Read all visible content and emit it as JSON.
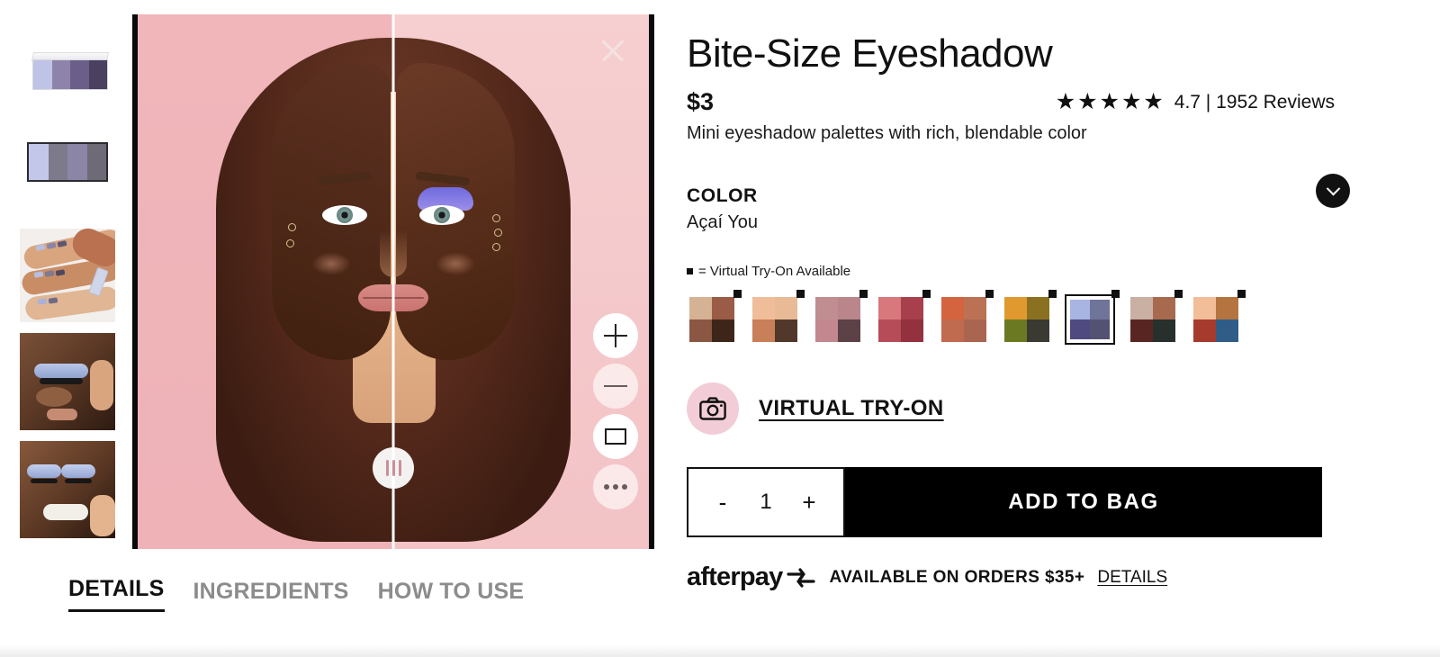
{
  "product": {
    "title": "Bite-Size Eyeshadow",
    "price": "$3",
    "rating_stars": "★★★★★",
    "rating_text": "4.7  |  1952 Reviews",
    "subtitle": "Mini eyeshadow palettes with rich, blendable color"
  },
  "color_section": {
    "label": "COLOR",
    "selected_value": "Açaí You",
    "vto_note": "= Virtual Try-On Available",
    "expand_icon": "chevron-down-icon",
    "swatches": [
      {
        "name": "swatch-1",
        "vto": true,
        "selected": false,
        "colors": [
          "#d6b295",
          "#9a5c46",
          "#8c5742",
          "#3d2619"
        ]
      },
      {
        "name": "swatch-2",
        "vto": true,
        "selected": false,
        "colors": [
          "#f0bd9a",
          "#e8ba95",
          "#c97f57",
          "#51382a"
        ]
      },
      {
        "name": "swatch-3",
        "vto": true,
        "selected": false,
        "colors": [
          "#c08d90",
          "#ba868c",
          "#c2878f",
          "#5c4147"
        ]
      },
      {
        "name": "swatch-4",
        "vto": true,
        "selected": false,
        "colors": [
          "#d8777c",
          "#a83f4c",
          "#b74c59",
          "#93313e"
        ]
      },
      {
        "name": "swatch-5",
        "vto": true,
        "selected": false,
        "colors": [
          "#d4643f",
          "#bb7254",
          "#c06a4f",
          "#a9654f"
        ]
      },
      {
        "name": "swatch-6",
        "vto": true,
        "selected": false,
        "colors": [
          "#e0992f",
          "#8a7121",
          "#6b7a22",
          "#3a3a33"
        ]
      },
      {
        "name": "swatch-7",
        "vto": true,
        "selected": true,
        "colors": [
          "#a8b4e2",
          "#6f7499",
          "#4f4a80",
          "#545273"
        ]
      },
      {
        "name": "swatch-8",
        "vto": true,
        "selected": false,
        "colors": [
          "#c9b0a2",
          "#a76a4e",
          "#592522",
          "#27302c"
        ]
      },
      {
        "name": "swatch-9",
        "vto": true,
        "selected": false,
        "colors": [
          "#f2bd99",
          "#b5743f",
          "#a63a2d",
          "#2f5d87"
        ]
      }
    ]
  },
  "virtual_tryon": {
    "icon": "camera-icon",
    "label": "VIRTUAL TRY-ON"
  },
  "purchase": {
    "decrement_label": "-",
    "quantity": "1",
    "increment_label": "+",
    "add_to_bag_label": "ADD TO BAG"
  },
  "afterpay": {
    "logo_text": "afterpay",
    "logo_icon": "afterpay-arrows-icon",
    "message": "AVAILABLE ON ORDERS $35+",
    "details_label": "DETAILS"
  },
  "tabs": [
    {
      "label": "DETAILS",
      "active": true
    },
    {
      "label": "INGREDIENTS",
      "active": false
    },
    {
      "label": "HOW TO USE",
      "active": false
    }
  ],
  "viewer": {
    "close_icon": "close-icon",
    "zoom_in_icon": "plus-icon",
    "zoom_out_icon": "minus-icon",
    "fullscreen_icon": "rectangle-icon",
    "more_icon": "more-dots-icon",
    "compare_handle_icon": "compare-slider-handle-icon"
  },
  "thumbnails": [
    {
      "name": "thumbnail-palette-open"
    },
    {
      "name": "thumbnail-palette-pans"
    },
    {
      "name": "thumbnail-arm-swatches"
    },
    {
      "name": "thumbnail-model-closeup"
    },
    {
      "name": "thumbnail-model-smiling"
    }
  ],
  "colors": {
    "accent_pink": "#f2ccd6",
    "stage_bg": "#efb9bd",
    "black": "#000000"
  }
}
